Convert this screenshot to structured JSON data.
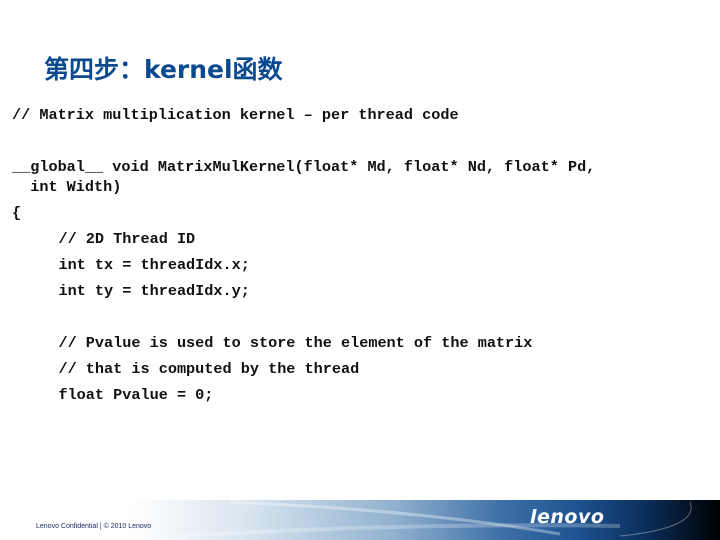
{
  "slide": {
    "title": "第四步：kernel函数",
    "code_lines": [
      "// Matrix multiplication kernel – per thread code",
      "__global__ void MatrixMulKernel(float* Md, float* Nd, float* Pd,",
      "  int Width)",
      "{",
      "    // 2D Thread ID",
      "    int tx = threadIdx.x;",
      "    int ty = threadIdx.y;",
      "",
      "    // Pvalue is used to store the element of the matrix",
      "    // that is computed by the thread",
      "    float Pvalue = 0;"
    ]
  },
  "footer": {
    "confidential": "Lenovo Confidential | © 2010 Lenovo",
    "logo": "lenovo"
  }
}
